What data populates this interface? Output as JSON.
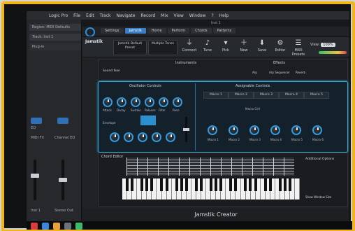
{
  "menubar": {
    "items": [
      "Logic Pro",
      "File",
      "Edit",
      "Track",
      "Navigate",
      "Record",
      "Mix",
      "View",
      "Window",
      "?",
      "Help"
    ]
  },
  "window": {
    "title": "Inst 1"
  },
  "sidebar": {
    "region_label": "Region: MIDI Defaults",
    "track_label": "Track: Inst 1",
    "plugin_label": "Plug-in",
    "eq_label": "EQ",
    "midi_fx_label": "MIDI FX",
    "channel_eq_label": "Channel EQ",
    "stereo_out_label": "Stereo Out",
    "inst1_label": "Inst 1",
    "out_label": "Stereo Out"
  },
  "tabs": [
    "Settings",
    "Jamstik",
    "Home",
    "Perform",
    "Chords",
    "Patterns"
  ],
  "tab_active_index": 0,
  "toolbar": {
    "brand": "Jamstik",
    "items": [
      {
        "label": "Connect",
        "icon": "plug-icon"
      },
      {
        "label": "Tune",
        "icon": "tuning-fork-icon"
      },
      {
        "label": "Pick",
        "icon": "pick-icon"
      },
      {
        "label": "New",
        "icon": "plus-icon"
      },
      {
        "label": "Save",
        "icon": "save-icon"
      },
      {
        "label": "Editor",
        "icon": "editor-icon"
      },
      {
        "label": "MIDI Presets",
        "icon": "presets-icon"
      }
    ],
    "preset1": "Jamstik Default Preset",
    "preset2": "Multiple Tones",
    "view_label": "View:",
    "zoom": "100%",
    "volume_label": "Volume"
  },
  "instruments": {
    "title": "Instruments",
    "sound_label": "Sound Ikon",
    "effects_title": "Effects",
    "effects": [
      "Arp",
      "Arp Sequencer",
      "Reverb"
    ]
  },
  "oscillator": {
    "title": "Oscillator Controls",
    "knob_labels": [
      "Attack",
      "Decay",
      "Sustain",
      "Release",
      "Filter",
      "Reso",
      "Env",
      "Drive",
      "Delay",
      "Rate",
      "Depth",
      "Mix"
    ],
    "envelope_label": "Envelope"
  },
  "assignable": {
    "title": "Assignable Controls",
    "tabs": [
      "Macro 1",
      "Macro 2",
      "Macro 3",
      "Macro 4",
      "Macro 5"
    ],
    "macro_cell": "Macro Cell",
    "knobs": [
      "Macro 1",
      "Macro 2",
      "Macro 3",
      "Macro 4",
      "Macro 5",
      "Macro 6"
    ]
  },
  "chord_editor": {
    "title": "Chord Editor",
    "options_title": "Additional Options",
    "show_button": "Show Window Size"
  },
  "footer": {
    "title": "Jamstik Creator"
  },
  "colors": {
    "accent": "#2f9be0",
    "frame": "#f0b51e"
  }
}
